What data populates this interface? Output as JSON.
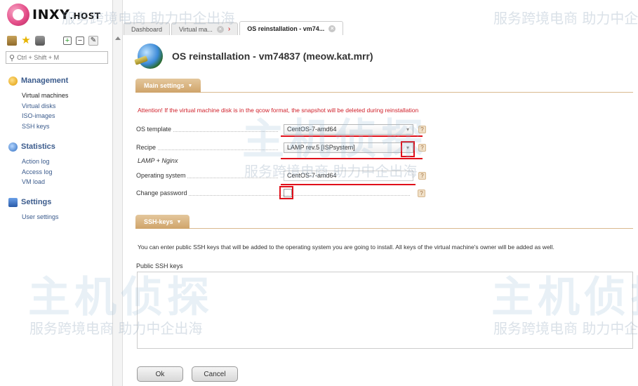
{
  "app": {
    "logo_text": "INXY",
    "logo_suffix": ".HOST"
  },
  "sidebar": {
    "search_placeholder": "Ctrl + Shift + M",
    "groups": [
      {
        "title": "Management",
        "items": [
          "Virtual machines",
          "Virtual disks",
          "ISO-images",
          "SSH keys"
        ]
      },
      {
        "title": "Statistics",
        "items": [
          "Action log",
          "Access log",
          "VM load"
        ]
      },
      {
        "title": "Settings",
        "items": [
          "User settings"
        ]
      }
    ]
  },
  "tabs": [
    {
      "label": "Dashboard"
    },
    {
      "label": "Virtual ma..."
    },
    {
      "label": "OS reinstallation - vm74..."
    }
  ],
  "page": {
    "title": "OS reinstallation - vm74837 (meow.kat.mrr)"
  },
  "main_settings": {
    "section_label": "Main settings",
    "warning": "Attention! If the virtual machine disk is in the qcow format, the snapshot will be deleted during reinstallation",
    "os_template_label": "OS template",
    "os_template_value": "CentOS-7-amd64",
    "recipe_label": "Recipe",
    "recipe_value": "LAMP rev.5 [ISPsystem]",
    "recipe_note": "LAMP + Nginx",
    "operating_system_label": "Operating system",
    "operating_system_value": "CentOS-7-amd64",
    "change_password_label": "Change password",
    "help_symbol": "?"
  },
  "ssh_keys": {
    "section_label": "SSH-keys",
    "info": "You can enter public SSH keys that will be added to the operating system you are going to install. All keys of the virtual machine's owner will be added as well.",
    "field_label": "Public SSH keys"
  },
  "buttons": {
    "ok": "Ok",
    "cancel": "Cancel"
  },
  "watermark": {
    "brand": "主机侦探",
    "slogan": "服务跨境电商 助力中企出海"
  }
}
